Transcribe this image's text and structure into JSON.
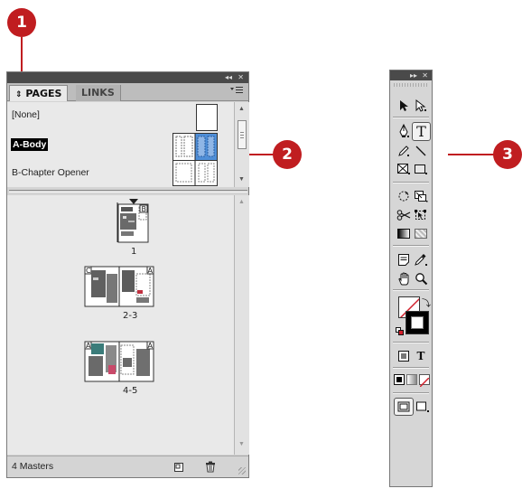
{
  "callouts": [
    "1",
    "2",
    "3"
  ],
  "pages_panel": {
    "titlebar": {
      "collapse_glyph": "◂◂",
      "close_glyph": "✕"
    },
    "tabs": [
      {
        "label": "PAGES",
        "prefix": "⇕"
      },
      {
        "label": "LINKS"
      }
    ],
    "menu_icon": "panel-menu-icon",
    "masters": [
      {
        "label": "[None]",
        "selected": false
      },
      {
        "label": "A-Body",
        "selected": true
      },
      {
        "label": "B-Chapter Opener",
        "selected": false
      }
    ],
    "pages": [
      {
        "label": "1",
        "master": "B"
      },
      {
        "label": "2-3",
        "master": "A"
      },
      {
        "label": "4-5",
        "master": "A"
      }
    ],
    "footer": {
      "count_text": "4 Masters",
      "new_page_icon": "new-page-icon",
      "trash_icon": "trash-icon"
    }
  },
  "tools_panel": {
    "titlebar": {
      "expand_glyph": "▸▸",
      "close_glyph": "✕"
    },
    "type_tool_glyph": "T",
    "text_mode_glyph": "T",
    "tools": [
      "selection",
      "direct-selection",
      "pen",
      "type",
      "pencil",
      "line",
      "rectangle-frame",
      "rectangle",
      "rotate",
      "scale",
      "scissors",
      "free-transform",
      "gradient-swatch",
      "gradient-feather",
      "note",
      "eyedropper",
      "hand",
      "zoom"
    ],
    "colors": {
      "accent": "#c01d20",
      "selected_master_bg": "#000000"
    }
  }
}
